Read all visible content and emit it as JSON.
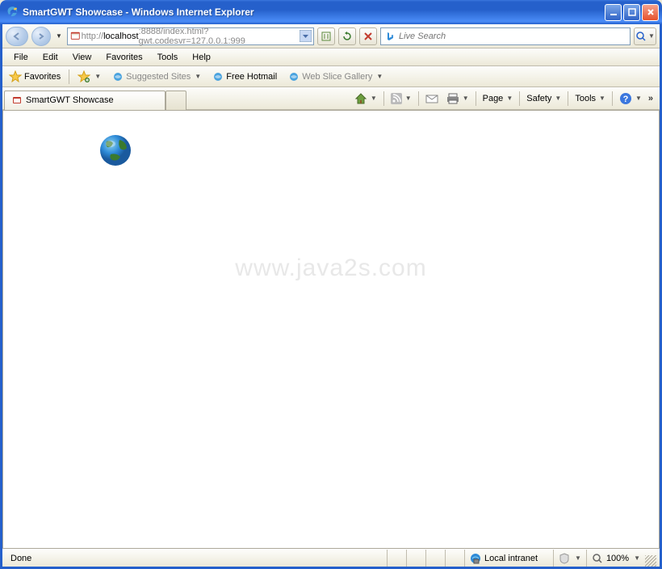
{
  "window": {
    "title": "SmartGWT Showcase - Windows Internet Explorer"
  },
  "address": {
    "prefix": "http://",
    "host": "localhost",
    "rest": ":8888/index.html?gwt.codesvr=127.0.0.1:999"
  },
  "search": {
    "placeholder": "Live Search"
  },
  "menu": {
    "file": "File",
    "edit": "Edit",
    "view": "View",
    "favorites": "Favorites",
    "tools": "Tools",
    "help": "Help"
  },
  "favbar": {
    "favorites": "Favorites",
    "suggested": "Suggested Sites",
    "hotmail": "Free Hotmail",
    "webslice": "Web Slice Gallery"
  },
  "tabs": {
    "active": "SmartGWT Showcase"
  },
  "commands": {
    "page": "Page",
    "safety": "Safety",
    "tools": "Tools"
  },
  "content": {
    "watermark": "www.java2s.com"
  },
  "status": {
    "left": "Done",
    "zone": "Local intranet",
    "zoom": "100%"
  }
}
